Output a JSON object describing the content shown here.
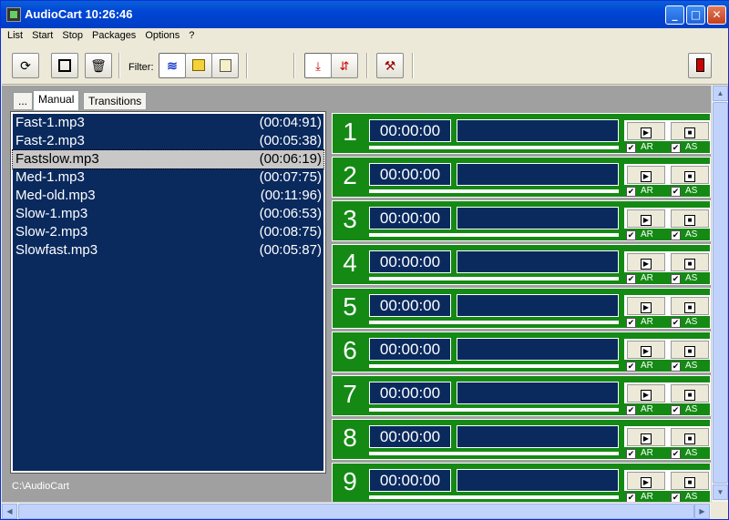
{
  "window": {
    "title": "AudioCart 10:26:46"
  },
  "menu": [
    "List",
    "Start",
    "Stop",
    "Packages",
    "Options",
    "?"
  ],
  "toolbar": {
    "filter_label": "Filter:"
  },
  "tabs": {
    "browse": "...",
    "manual": "Manual",
    "transitions": "Transitions"
  },
  "files": [
    {
      "name": "Fast-1.mp3",
      "duration": "(00:04:91)"
    },
    {
      "name": "Fast-2.mp3",
      "duration": "(00:05:38)"
    },
    {
      "name": "Fastslow.mp3",
      "duration": "(00:06:19)"
    },
    {
      "name": "Med-1.mp3",
      "duration": "(00:07:75)"
    },
    {
      "name": "Med-old.mp3",
      "duration": "(00:11:96)"
    },
    {
      "name": "Slow-1.mp3",
      "duration": "(00:06:53)"
    },
    {
      "name": "Slow-2.mp3",
      "duration": "(00:08:75)"
    },
    {
      "name": "Slowfast.mp3",
      "duration": "(00:05:87)"
    }
  ],
  "selected_file_index": 2,
  "path": "C:\\AudioCart",
  "carts": [
    {
      "number": "1",
      "time": "00:00:00",
      "ar": "AR",
      "as": "AS"
    },
    {
      "number": "2",
      "time": "00:00:00",
      "ar": "AR",
      "as": "AS"
    },
    {
      "number": "3",
      "time": "00:00:00",
      "ar": "AR",
      "as": "AS"
    },
    {
      "number": "4",
      "time": "00:00:00",
      "ar": "AR",
      "as": "AS"
    },
    {
      "number": "5",
      "time": "00:00:00",
      "ar": "AR",
      "as": "AS"
    },
    {
      "number": "6",
      "time": "00:00:00",
      "ar": "AR",
      "as": "AS"
    },
    {
      "number": "7",
      "time": "00:00:00",
      "ar": "AR",
      "as": "AS"
    },
    {
      "number": "8",
      "time": "00:00:00",
      "ar": "AR",
      "as": "AS"
    },
    {
      "number": "9",
      "time": "00:00:00",
      "ar": "AR",
      "as": "AS"
    }
  ],
  "colors": {
    "list_bg": "#0a2a5e",
    "cart_bg": "#148a14",
    "title_bar": "#0046d5"
  }
}
